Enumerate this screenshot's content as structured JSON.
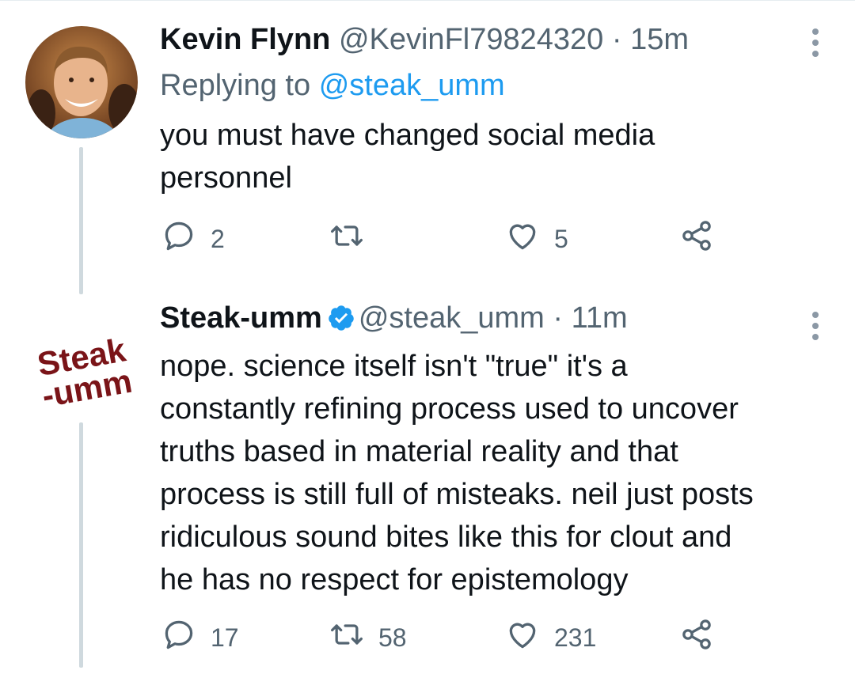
{
  "tweets": [
    {
      "name": "Kevin Flynn",
      "handle": "@KevinFl79824320",
      "separator": "·",
      "time": "15m",
      "replying_prefix": "Replying to",
      "replying_to": "@steak_umm",
      "lines": [
        "you must have changed social media",
        "personnel"
      ],
      "reply_count": "2",
      "retweet_count": "",
      "like_count": "5"
    },
    {
      "name": "Steak-umm",
      "handle": "@steak_umm",
      "separator": "·",
      "time": "11m",
      "verified": true,
      "lines": [
        "nope. science itself isn't \"true\" it's a",
        "constantly refining process used to uncover",
        "truths based in material reality and that",
        "process is still full of misteaks. neil just posts",
        "ridiculous sound bites like this for clout and",
        "he has no respect for epistemology"
      ],
      "reply_count": "17",
      "retweet_count": "58",
      "like_count": "231"
    }
  ],
  "avatar_logo": {
    "line1": "Steak",
    "line2": "-umm"
  },
  "colors": {
    "text": "#0f1419",
    "secondary": "#536471",
    "link": "#1d9bf0",
    "thread_line": "#cfd9de",
    "brand_red": "#7a1418"
  },
  "icons": [
    "reply-icon",
    "retweet-icon",
    "like-icon",
    "share-icon",
    "more-icon",
    "verified-badge-icon"
  ]
}
